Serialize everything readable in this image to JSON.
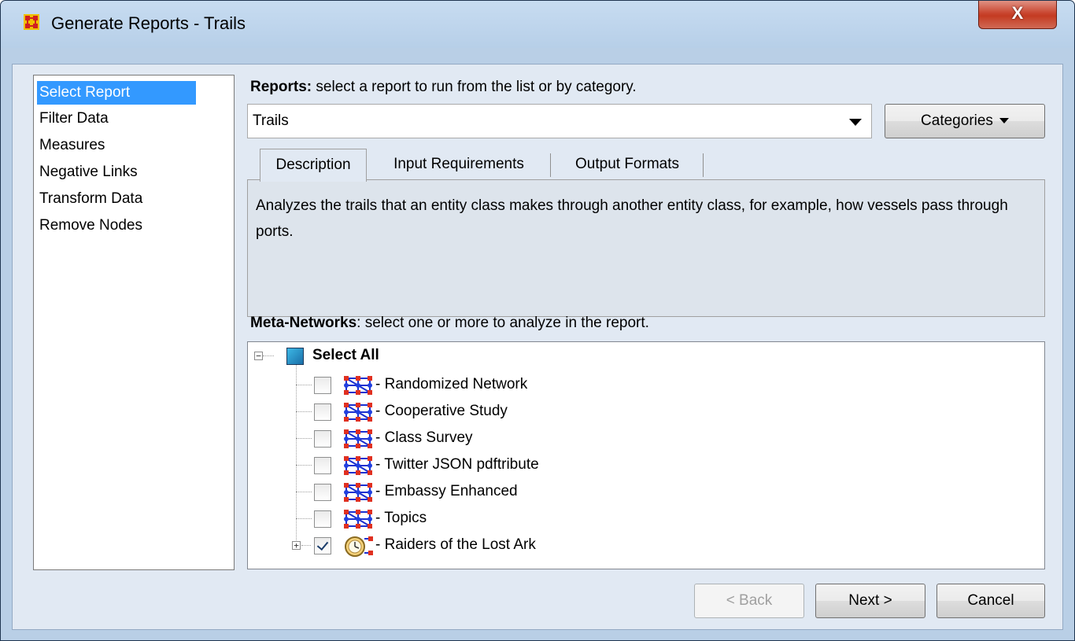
{
  "window": {
    "title": "Generate Reports - Trails",
    "close_label": "X"
  },
  "nav": {
    "items": [
      {
        "label": "Select Report",
        "selected": true
      },
      {
        "label": "Filter Data",
        "selected": false
      },
      {
        "label": "Measures",
        "selected": false
      },
      {
        "label": "Negative Links",
        "selected": false
      },
      {
        "label": "Transform Data",
        "selected": false
      },
      {
        "label": "Remove Nodes",
        "selected": false
      }
    ]
  },
  "reports": {
    "heading_bold": "Reports:",
    "heading_rest": " select a report to run from the list or by category.",
    "selected_report": "Trails",
    "categories_label": "Categories"
  },
  "tabs": {
    "items": [
      {
        "label": "Description",
        "active": true
      },
      {
        "label": "Input Requirements",
        "active": false
      },
      {
        "label": "Output Formats",
        "active": false
      }
    ],
    "description_text": "Analyzes the trails that an entity class makes through another entity class, for example, how vessels pass through ports."
  },
  "meta_networks": {
    "heading_bold": "Meta-Networks",
    "heading_rest": ": select one or more to analyze in the report.",
    "select_all_label": "Select All",
    "expander_collapse": "−",
    "expander_expand": "+",
    "items": [
      {
        "label": "- Randomized Network",
        "checked": false,
        "icon": "network-icon"
      },
      {
        "label": "- Cooperative Study",
        "checked": false,
        "icon": "network-icon"
      },
      {
        "label": "- Class Survey",
        "checked": false,
        "icon": "network-icon"
      },
      {
        "label": "- Twitter JSON pdftribute",
        "checked": false,
        "icon": "network-icon"
      },
      {
        "label": "- Embassy Enhanced",
        "checked": false,
        "icon": "network-icon"
      },
      {
        "label": "- Topics",
        "checked": false,
        "icon": "network-icon"
      },
      {
        "label": "- Raiders of the Lost Ark",
        "checked": true,
        "icon": "clock-network-icon"
      }
    ]
  },
  "footer": {
    "back_label": "< Back",
    "next_label": "Next >",
    "cancel_label": "Cancel"
  }
}
